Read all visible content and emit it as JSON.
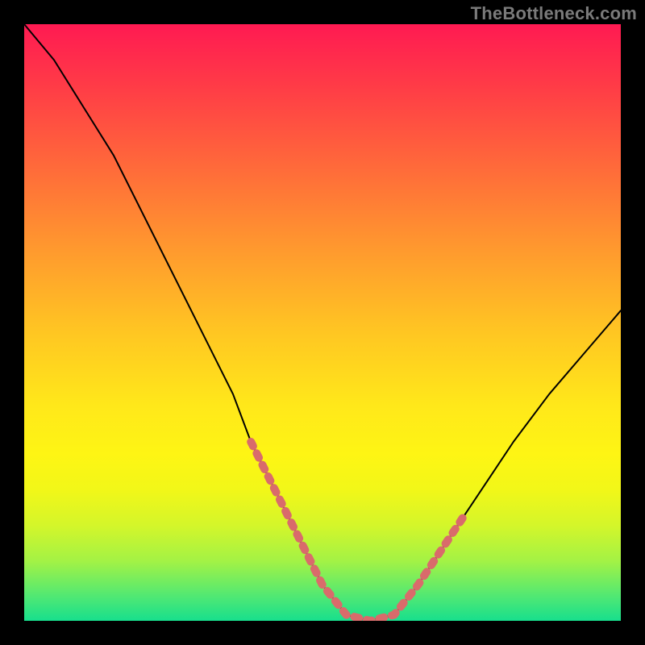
{
  "watermark": "TheBottleneck.com",
  "colors": {
    "background": "#000000",
    "gradient_top": "#ff1a52",
    "gradient_mid": "#ffe81a",
    "gradient_bottom": "#17df8d",
    "curve": "#000000",
    "highlight_dots": "#d96b6b"
  },
  "chart_data": {
    "type": "line",
    "title": "",
    "xlabel": "",
    "ylabel": "",
    "xlim": [
      0,
      100
    ],
    "ylim": [
      0,
      100
    ],
    "grid": false,
    "legend": false,
    "series": [
      {
        "name": "bottleneck-curve",
        "description": "V-shaped curve: steep descent from upper-left, flat trough around x≈52–62, rising toward upper-right; value shown is approximate height (0 = bottom/green, 100 = top/red).",
        "x": [
          0,
          5,
          10,
          15,
          20,
          25,
          30,
          35,
          38,
          42,
          46,
          50,
          54,
          58,
          62,
          66,
          70,
          74,
          78,
          82,
          88,
          94,
          100
        ],
        "values": [
          100,
          94,
          86,
          78,
          68,
          58,
          48,
          38,
          30,
          22,
          14,
          6,
          1,
          0,
          1,
          6,
          12,
          18,
          24,
          30,
          38,
          45,
          52
        ]
      }
    ],
    "highlight_range": {
      "description": "salmon dotted overlay on the curve near the trough",
      "x_start": 38,
      "x_end": 74
    }
  }
}
